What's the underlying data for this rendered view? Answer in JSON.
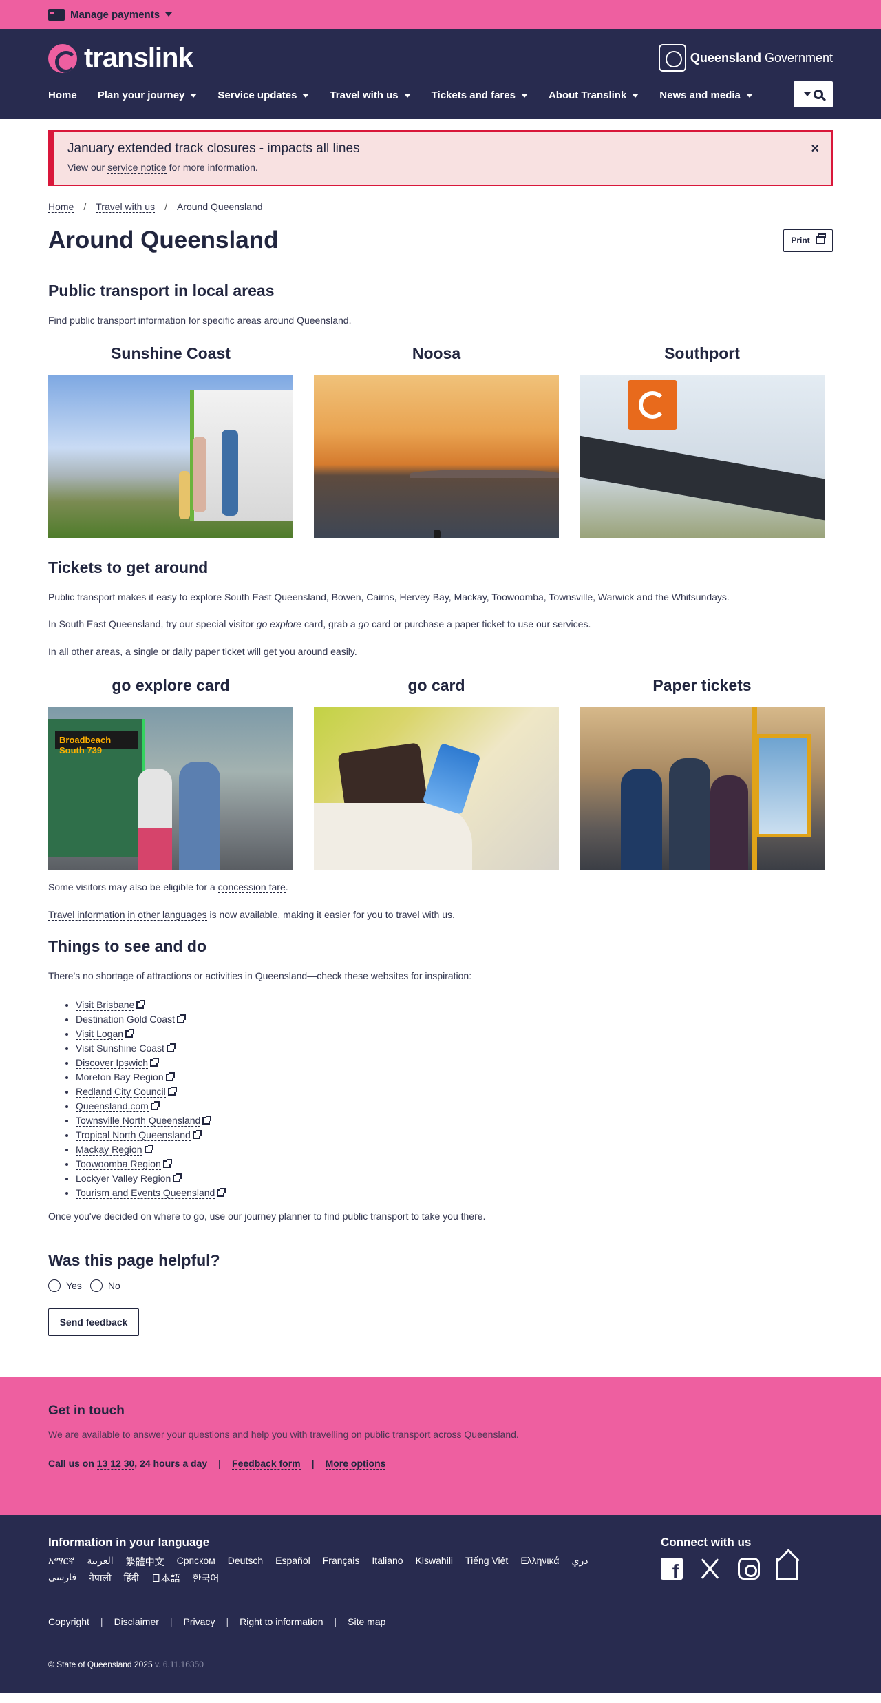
{
  "topbar": {
    "manage_payments": "Manage payments"
  },
  "header": {
    "logo_text": "translink",
    "qgov_bold": "Queensland",
    "qgov_rest": " Government",
    "nav": [
      "Home",
      "Plan your journey",
      "Service updates",
      "Travel with us",
      "Tickets and fares",
      "About Translink",
      "News and media"
    ]
  },
  "alert": {
    "title": "January extended track closures - impacts all lines",
    "text_before": "View our ",
    "link": "service notice",
    "text_after": " for more information.",
    "close": "×"
  },
  "breadcrumb": {
    "home": "Home",
    "travel": "Travel with us",
    "current": "Around Queensland",
    "sep": "/"
  },
  "page": {
    "title": "Around Queensland",
    "print_label": "Print"
  },
  "section_local": {
    "heading": "Public transport in local areas",
    "intro": "Find public transport information for specific areas around Queensland.",
    "tiles": [
      "Sunshine Coast",
      "Noosa",
      "Southport"
    ]
  },
  "section_tickets": {
    "heading": "Tickets to get around",
    "p1": "Public transport makes it easy to explore South East Queensland, Bowen, Cairns, Hervey Bay, Mackay, Toowoomba, Townsville, Warwick and the Whitsundays.",
    "p2_a": "In South East Queensland, try our special visitor ",
    "p2_em1": "go explore",
    "p2_b": " card, grab a ",
    "p2_em2": "go",
    "p2_c": " card or purchase a paper ticket to use our services.",
    "p3": "In all other areas, a single or daily paper ticket will get you around easily.",
    "tiles": [
      "go explore card",
      "go card",
      "Paper tickets"
    ],
    "bus_dest": "Broadbeach South  739",
    "concession_a": "Some visitors may also be eligible for a ",
    "concession_link": "concession fare",
    "concession_b": ".",
    "lang_link": "Travel information in other languages",
    "lang_after": " is now available, making it easier for you to travel with us."
  },
  "section_things": {
    "heading": "Things to see and do",
    "intro": "There's no shortage of attractions or activities in Queensland—check these websites for inspiration:",
    "links": [
      "Visit Brisbane",
      "Destination Gold Coast",
      "Visit Logan",
      "Visit Sunshine Coast",
      "Discover Ipswich",
      "Moreton Bay Region",
      "Redland City Council",
      "Queensland.com",
      "Townsville North Queensland",
      "Tropical North Queensland",
      "Mackay Region",
      "Toowoomba Region",
      "Lockyer Valley Region",
      "Tourism and Events Queensland"
    ],
    "outro_a": "Once you've decided on where to go, use our ",
    "outro_link": "journey planner",
    "outro_b": " to find public transport to take you there."
  },
  "feedback": {
    "heading": "Was this page helpful?",
    "yes": "Yes",
    "no": "No",
    "send": "Send feedback"
  },
  "touch": {
    "heading": "Get in touch",
    "text": "We are available to answer your questions and help you with travelling on public transport across Queensland.",
    "call_a": "Call us on ",
    "phone": "13 12 30",
    "call_b": ", 24 hours a day",
    "feedback_form": "Feedback form",
    "more_options": "More options",
    "sep": "|"
  },
  "footer": {
    "lang_heading": "Information in your language",
    "languages": [
      "አማርኛ",
      "العربية",
      "繁體中文",
      "Српском",
      "Deutsch",
      "Español",
      "Français",
      "Italiano",
      "Kiswahili",
      "Tiếng Việt",
      "Ελληνικά",
      "دري",
      "فارسی",
      "नेपाली",
      "हिंदी",
      "日本語",
      "한국어"
    ],
    "connect_heading": "Connect with us",
    "links": [
      "Copyright",
      "Disclaimer",
      "Privacy",
      "Right to information",
      "Site map"
    ],
    "sep": "|",
    "copyright": "© State of Queensland 2025",
    "version": " v. 6.11.16350"
  },
  "colors": {
    "brand_pink": "#ee5fa0",
    "navy": "#282b4f",
    "alert_red": "#d9173a",
    "alert_bg": "#f8e1e1"
  },
  "icons": [
    "card-icon",
    "chevron-down-icon",
    "search-icon",
    "close-icon",
    "printer-icon",
    "external-link-icon",
    "facebook-icon",
    "x-icon",
    "instagram-icon",
    "email-icon"
  ]
}
